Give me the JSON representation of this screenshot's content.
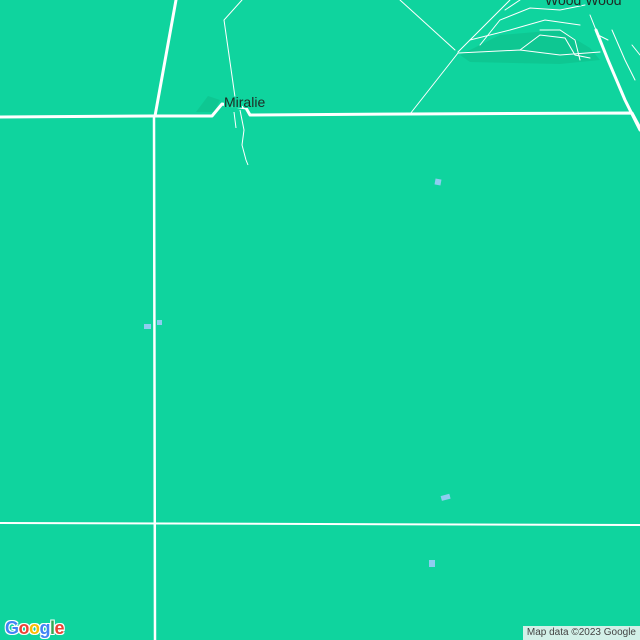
{
  "map": {
    "land_color": "#0fd49e",
    "road_color": "#ffffff",
    "water_color": "#8ecdf0",
    "places": [
      {
        "name": "Miralie"
      },
      {
        "name": "Wood Wood"
      }
    ]
  },
  "logo": {
    "text": "Google",
    "icon": "google-logo"
  },
  "attribution": {
    "text": "Map data ©2023 Google"
  }
}
